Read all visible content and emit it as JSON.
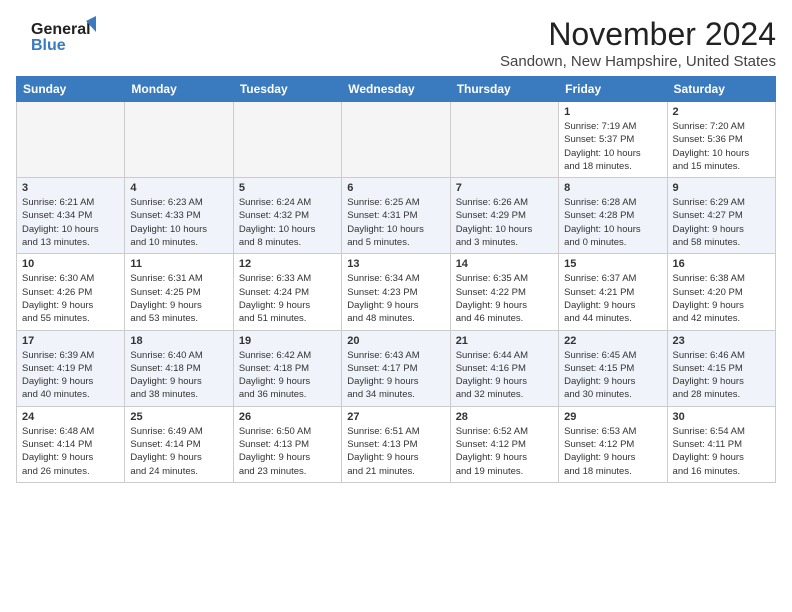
{
  "header": {
    "logo_line1": "General",
    "logo_line2": "Blue",
    "month_title": "November 2024",
    "location": "Sandown, New Hampshire, United States"
  },
  "weekdays": [
    "Sunday",
    "Monday",
    "Tuesday",
    "Wednesday",
    "Thursday",
    "Friday",
    "Saturday"
  ],
  "weeks": [
    [
      {
        "day": "",
        "info": ""
      },
      {
        "day": "",
        "info": ""
      },
      {
        "day": "",
        "info": ""
      },
      {
        "day": "",
        "info": ""
      },
      {
        "day": "",
        "info": ""
      },
      {
        "day": "1",
        "info": "Sunrise: 7:19 AM\nSunset: 5:37 PM\nDaylight: 10 hours\nand 18 minutes."
      },
      {
        "day": "2",
        "info": "Sunrise: 7:20 AM\nSunset: 5:36 PM\nDaylight: 10 hours\nand 15 minutes."
      }
    ],
    [
      {
        "day": "3",
        "info": "Sunrise: 6:21 AM\nSunset: 4:34 PM\nDaylight: 10 hours\nand 13 minutes."
      },
      {
        "day": "4",
        "info": "Sunrise: 6:23 AM\nSunset: 4:33 PM\nDaylight: 10 hours\nand 10 minutes."
      },
      {
        "day": "5",
        "info": "Sunrise: 6:24 AM\nSunset: 4:32 PM\nDaylight: 10 hours\nand 8 minutes."
      },
      {
        "day": "6",
        "info": "Sunrise: 6:25 AM\nSunset: 4:31 PM\nDaylight: 10 hours\nand 5 minutes."
      },
      {
        "day": "7",
        "info": "Sunrise: 6:26 AM\nSunset: 4:29 PM\nDaylight: 10 hours\nand 3 minutes."
      },
      {
        "day": "8",
        "info": "Sunrise: 6:28 AM\nSunset: 4:28 PM\nDaylight: 10 hours\nand 0 minutes."
      },
      {
        "day": "9",
        "info": "Sunrise: 6:29 AM\nSunset: 4:27 PM\nDaylight: 9 hours\nand 58 minutes."
      }
    ],
    [
      {
        "day": "10",
        "info": "Sunrise: 6:30 AM\nSunset: 4:26 PM\nDaylight: 9 hours\nand 55 minutes."
      },
      {
        "day": "11",
        "info": "Sunrise: 6:31 AM\nSunset: 4:25 PM\nDaylight: 9 hours\nand 53 minutes."
      },
      {
        "day": "12",
        "info": "Sunrise: 6:33 AM\nSunset: 4:24 PM\nDaylight: 9 hours\nand 51 minutes."
      },
      {
        "day": "13",
        "info": "Sunrise: 6:34 AM\nSunset: 4:23 PM\nDaylight: 9 hours\nand 48 minutes."
      },
      {
        "day": "14",
        "info": "Sunrise: 6:35 AM\nSunset: 4:22 PM\nDaylight: 9 hours\nand 46 minutes."
      },
      {
        "day": "15",
        "info": "Sunrise: 6:37 AM\nSunset: 4:21 PM\nDaylight: 9 hours\nand 44 minutes."
      },
      {
        "day": "16",
        "info": "Sunrise: 6:38 AM\nSunset: 4:20 PM\nDaylight: 9 hours\nand 42 minutes."
      }
    ],
    [
      {
        "day": "17",
        "info": "Sunrise: 6:39 AM\nSunset: 4:19 PM\nDaylight: 9 hours\nand 40 minutes."
      },
      {
        "day": "18",
        "info": "Sunrise: 6:40 AM\nSunset: 4:18 PM\nDaylight: 9 hours\nand 38 minutes."
      },
      {
        "day": "19",
        "info": "Sunrise: 6:42 AM\nSunset: 4:18 PM\nDaylight: 9 hours\nand 36 minutes."
      },
      {
        "day": "20",
        "info": "Sunrise: 6:43 AM\nSunset: 4:17 PM\nDaylight: 9 hours\nand 34 minutes."
      },
      {
        "day": "21",
        "info": "Sunrise: 6:44 AM\nSunset: 4:16 PM\nDaylight: 9 hours\nand 32 minutes."
      },
      {
        "day": "22",
        "info": "Sunrise: 6:45 AM\nSunset: 4:15 PM\nDaylight: 9 hours\nand 30 minutes."
      },
      {
        "day": "23",
        "info": "Sunrise: 6:46 AM\nSunset: 4:15 PM\nDaylight: 9 hours\nand 28 minutes."
      }
    ],
    [
      {
        "day": "24",
        "info": "Sunrise: 6:48 AM\nSunset: 4:14 PM\nDaylight: 9 hours\nand 26 minutes."
      },
      {
        "day": "25",
        "info": "Sunrise: 6:49 AM\nSunset: 4:14 PM\nDaylight: 9 hours\nand 24 minutes."
      },
      {
        "day": "26",
        "info": "Sunrise: 6:50 AM\nSunset: 4:13 PM\nDaylight: 9 hours\nand 23 minutes."
      },
      {
        "day": "27",
        "info": "Sunrise: 6:51 AM\nSunset: 4:13 PM\nDaylight: 9 hours\nand 21 minutes."
      },
      {
        "day": "28",
        "info": "Sunrise: 6:52 AM\nSunset: 4:12 PM\nDaylight: 9 hours\nand 19 minutes."
      },
      {
        "day": "29",
        "info": "Sunrise: 6:53 AM\nSunset: 4:12 PM\nDaylight: 9 hours\nand 18 minutes."
      },
      {
        "day": "30",
        "info": "Sunrise: 6:54 AM\nSunset: 4:11 PM\nDaylight: 9 hours\nand 16 minutes."
      }
    ]
  ]
}
